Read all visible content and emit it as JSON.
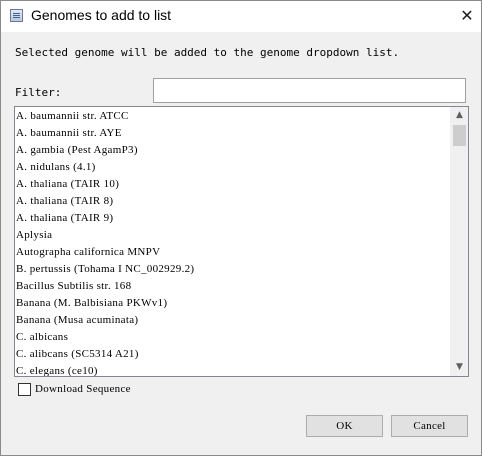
{
  "window": {
    "title": "Genomes to add to list",
    "close_glyph": "✕",
    "icon": "app-window-icon"
  },
  "description": "Selected genome will be added to the genome dropdown list.",
  "filter": {
    "label": "Filter:",
    "value": "",
    "placeholder": ""
  },
  "genomes": [
    "A. baumannii str. ATCC",
    "A. baumannii str. AYE",
    "A. gambia (Pest AgamP3)",
    "A. nidulans (4.1)",
    "A. thaliana (TAIR 10)",
    "A. thaliana (TAIR 8)",
    "A. thaliana (TAIR 9)",
    "Aplysia",
    "Autographa californica MNPV",
    "B. pertussis (Tohama I NC_002929.2)",
    "Bacillus Subtilis str. 168",
    "Banana (M. Balbisiana PKWv1)",
    "Banana (Musa acuminata)",
    "C. albicans",
    "C. alibcans (SC5314 A21)",
    "C. elegans (ce10)"
  ],
  "scrollbar": {
    "up_glyph": "▲",
    "down_glyph": "▼"
  },
  "download_sequence": {
    "label": "Download Sequence",
    "checked": false
  },
  "buttons": {
    "ok": "OK",
    "cancel": "Cancel"
  }
}
